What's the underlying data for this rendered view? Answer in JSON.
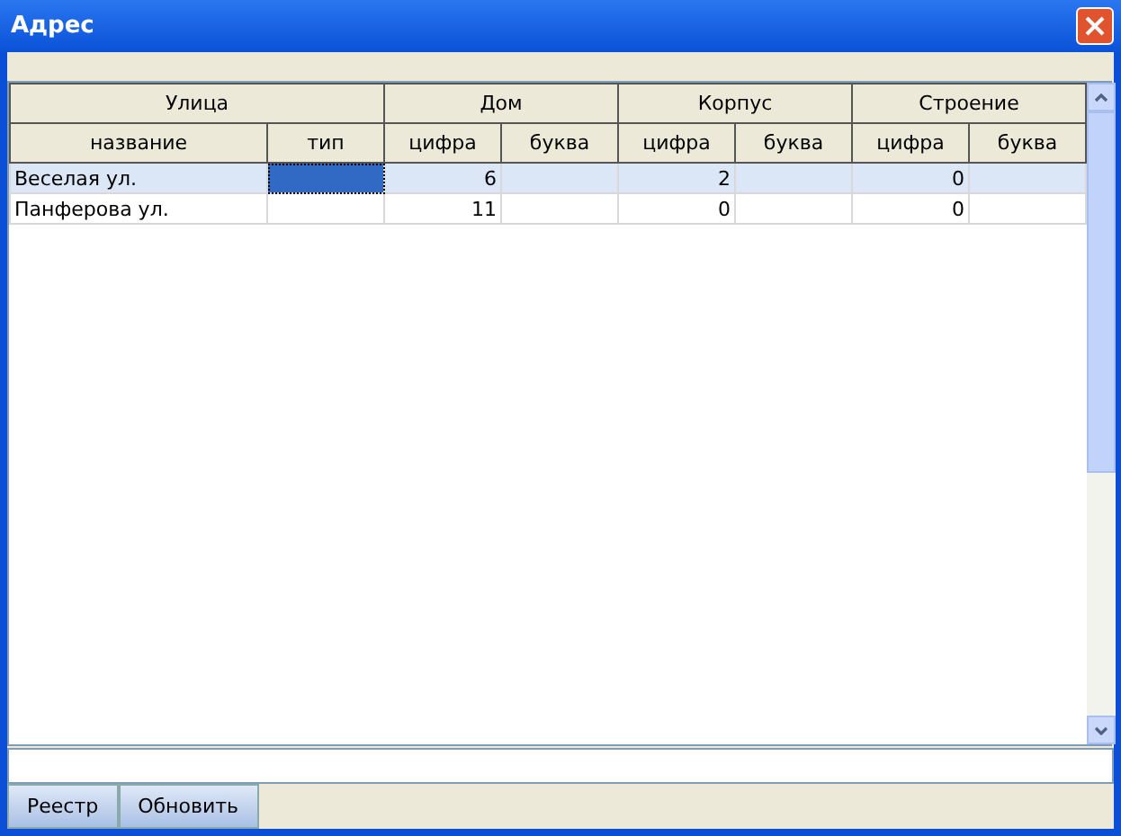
{
  "window": {
    "title": "Адрес"
  },
  "table": {
    "groups": [
      "Улица",
      "Дом",
      "Корпус",
      "Строение"
    ],
    "columns": [
      "название",
      "тип",
      "цифра",
      "буква",
      "цифра",
      "буква",
      "цифра",
      "буква"
    ],
    "rows": [
      {
        "selected": true,
        "cells": [
          {
            "text": "Веселая ул.",
            "focused": false
          },
          {
            "text": "",
            "focused": true
          },
          {
            "text": "6",
            "focused": false
          },
          {
            "text": "",
            "focused": false
          },
          {
            "text": "2",
            "focused": false
          },
          {
            "text": "",
            "focused": false
          },
          {
            "text": "0",
            "focused": false
          },
          {
            "text": "",
            "focused": false
          }
        ]
      },
      {
        "selected": false,
        "cells": [
          {
            "text": "Панферова ул.",
            "focused": false
          },
          {
            "text": "",
            "focused": false
          },
          {
            "text": "11",
            "focused": false
          },
          {
            "text": "",
            "focused": false
          },
          {
            "text": "0",
            "focused": false
          },
          {
            "text": "",
            "focused": false
          },
          {
            "text": "0",
            "focused": false
          },
          {
            "text": "",
            "focused": false
          }
        ]
      }
    ]
  },
  "buttons": [
    "Реестр",
    "Обновить"
  ]
}
